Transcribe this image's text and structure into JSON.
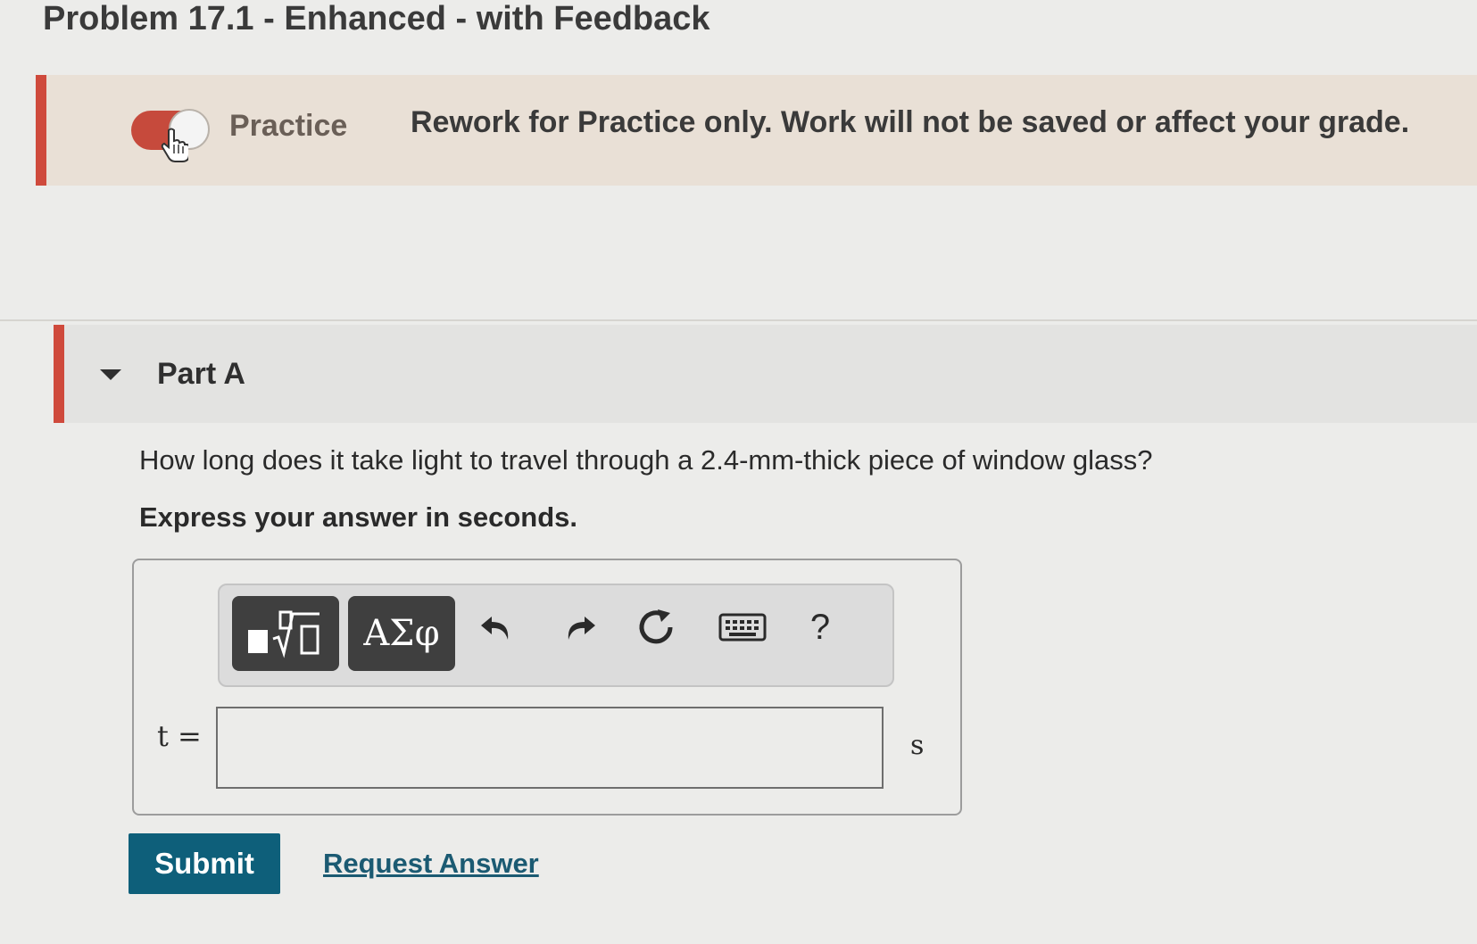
{
  "page": {
    "title": "Problem 17.1 - Enhanced - with Feedback"
  },
  "practice_banner": {
    "label": "Practice",
    "message": "Rework for Practice only. Work will not be saved or affect your grade."
  },
  "part": {
    "title": "Part A",
    "question": "How long does it take light to travel through a 2.4-mm-thick piece of window glass?",
    "instruction": "Express your answer in seconds."
  },
  "toolbar": {
    "symbols_label": "ΑΣφ",
    "help_label": "?",
    "icons": [
      "templates-icon",
      "symbols-icon",
      "undo-icon",
      "redo-icon",
      "reset-icon",
      "keyboard-icon",
      "help-icon"
    ]
  },
  "answer": {
    "variable": "t =",
    "value": "",
    "unit": "s"
  },
  "actions": {
    "submit_label": "Submit",
    "request_answer_label": "Request Answer"
  },
  "colors": {
    "accent": "#cf4a3c",
    "submit": "#0e5f7a",
    "link": "#1b5a72"
  }
}
